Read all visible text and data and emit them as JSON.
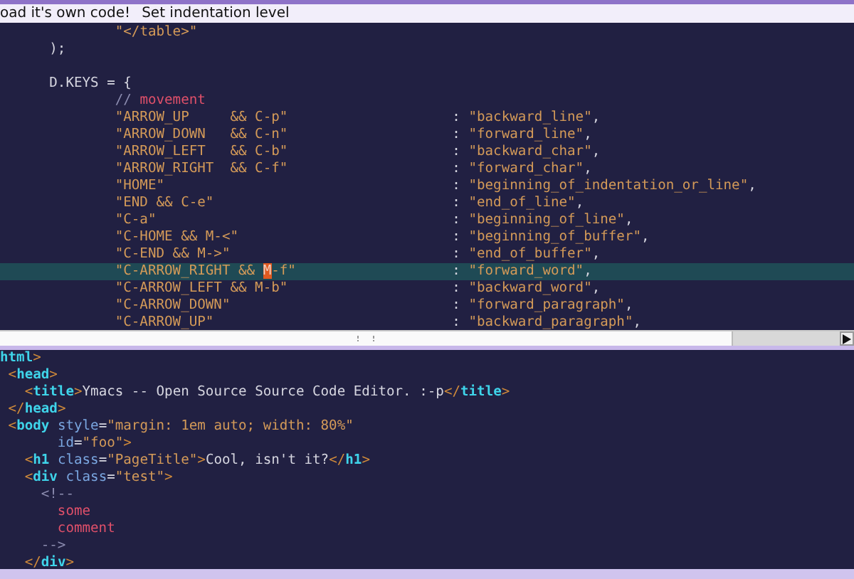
{
  "menu": [
    {
      "label": "oad it's own code!"
    },
    {
      "label": "Set indentation level"
    }
  ],
  "upper": {
    "lines": [
      {
        "kind": "code",
        "current": false,
        "tokens": [
          {
            "kind": "string",
            "text": "              \"</table>\""
          }
        ]
      },
      {
        "kind": "code",
        "current": false,
        "tokens": [
          {
            "kind": "plain",
            "text": "      );"
          }
        ]
      },
      {
        "kind": "blank",
        "current": false
      },
      {
        "kind": "code",
        "current": false,
        "tokens": [
          {
            "kind": "plain",
            "text": "      D.KEYS = {"
          }
        ]
      },
      {
        "kind": "code",
        "current": false,
        "tokens": [
          {
            "kind": "comment",
            "text": "              // "
          },
          {
            "kind": "commenttext",
            "text": "movement"
          }
        ]
      },
      {
        "kind": "pair",
        "current": false,
        "sep": ":",
        "key": [
          {
            "kind": "string",
            "text": "\"ARROW_UP     && C-p\""
          }
        ],
        "value": [
          {
            "kind": "string",
            "text": "\"backward_line\""
          },
          {
            "kind": "plain",
            "text": ","
          }
        ]
      },
      {
        "kind": "pair",
        "current": false,
        "sep": ":",
        "key": [
          {
            "kind": "string",
            "text": "\"ARROW_DOWN   && C-n\""
          }
        ],
        "value": [
          {
            "kind": "string",
            "text": "\"forward_line\""
          },
          {
            "kind": "plain",
            "text": ","
          }
        ]
      },
      {
        "kind": "pair",
        "current": false,
        "sep": ":",
        "key": [
          {
            "kind": "string",
            "text": "\"ARROW_LEFT   && C-b\""
          }
        ],
        "value": [
          {
            "kind": "string",
            "text": "\"backward_char\""
          },
          {
            "kind": "plain",
            "text": ","
          }
        ]
      },
      {
        "kind": "pair",
        "current": false,
        "sep": ":",
        "key": [
          {
            "kind": "string",
            "text": "\"ARROW_RIGHT  && C-f\""
          }
        ],
        "value": [
          {
            "kind": "string",
            "text": "\"forward_char\""
          },
          {
            "kind": "plain",
            "text": ","
          }
        ]
      },
      {
        "kind": "pair",
        "current": false,
        "sep": ":",
        "key": [
          {
            "kind": "string",
            "text": "\"HOME\""
          }
        ],
        "value": [
          {
            "kind": "string",
            "text": "\"beginning_of_indentation_or_line\""
          },
          {
            "kind": "plain",
            "text": ","
          }
        ]
      },
      {
        "kind": "pair",
        "current": false,
        "sep": ":",
        "key": [
          {
            "kind": "string",
            "text": "\"END && C-e\""
          }
        ],
        "value": [
          {
            "kind": "string",
            "text": "\"end_of_line\""
          },
          {
            "kind": "plain",
            "text": ","
          }
        ]
      },
      {
        "kind": "pair",
        "current": false,
        "sep": ":",
        "key": [
          {
            "kind": "string",
            "text": "\"C-a\""
          }
        ],
        "value": [
          {
            "kind": "string",
            "text": "\"beginning_of_line\""
          },
          {
            "kind": "plain",
            "text": ","
          }
        ]
      },
      {
        "kind": "pair",
        "current": false,
        "sep": ":",
        "key": [
          {
            "kind": "string",
            "text": "\"C-HOME && M-<\""
          }
        ],
        "value": [
          {
            "kind": "string",
            "text": "\"beginning_of_buffer\""
          },
          {
            "kind": "plain",
            "text": ","
          }
        ]
      },
      {
        "kind": "pair",
        "current": false,
        "sep": ":",
        "key": [
          {
            "kind": "string",
            "text": "\"C-END && M->\""
          }
        ],
        "value": [
          {
            "kind": "string",
            "text": "\"end_of_buffer\""
          },
          {
            "kind": "plain",
            "text": ","
          }
        ]
      },
      {
        "kind": "pair",
        "current": true,
        "sep": ":",
        "key": [
          {
            "kind": "string",
            "text": "\"C-ARROW_RIGHT && "
          },
          {
            "kind": "cursor",
            "text": "M"
          },
          {
            "kind": "string",
            "text": "-f\""
          }
        ],
        "value": [
          {
            "kind": "string",
            "text": "\"forward_word\""
          },
          {
            "kind": "plain",
            "text": ","
          }
        ]
      },
      {
        "kind": "pair",
        "current": false,
        "sep": ":",
        "key": [
          {
            "kind": "string",
            "text": "\"C-ARROW_LEFT && M-b\""
          }
        ],
        "value": [
          {
            "kind": "string",
            "text": "\"backward_word\""
          },
          {
            "kind": "plain",
            "text": ","
          }
        ]
      },
      {
        "kind": "pair",
        "current": false,
        "sep": ":",
        "key": [
          {
            "kind": "string",
            "text": "\"C-ARROW_DOWN\""
          }
        ],
        "value": [
          {
            "kind": "string",
            "text": "\"forward_paragraph\""
          },
          {
            "kind": "plain",
            "text": ","
          }
        ]
      },
      {
        "kind": "pair",
        "current": false,
        "sep": ":",
        "key": [
          {
            "kind": "string",
            "text": "\"C-ARROW_UP\""
          }
        ],
        "value": [
          {
            "kind": "string",
            "text": "\"backward_paragraph\""
          },
          {
            "kind": "plain",
            "text": ","
          }
        ]
      }
    ]
  },
  "lower": {
    "lines": [
      {
        "kind": "code",
        "current": false,
        "tokens": [
          {
            "kind": "tag",
            "text": "html"
          },
          {
            "kind": "punct",
            "text": ">"
          }
        ]
      },
      {
        "kind": "code",
        "current": false,
        "tokens": [
          {
            "kind": "punct",
            "text": " <"
          },
          {
            "kind": "tag",
            "text": "head"
          },
          {
            "kind": "punct",
            "text": ">"
          }
        ]
      },
      {
        "kind": "code",
        "current": false,
        "tokens": [
          {
            "kind": "punct",
            "text": "   <"
          },
          {
            "kind": "tag",
            "text": "title"
          },
          {
            "kind": "punct",
            "text": ">"
          },
          {
            "kind": "plain",
            "text": "Ymacs -- Open Source Source Code Editor. :-p"
          },
          {
            "kind": "punct",
            "text": "</"
          },
          {
            "kind": "tag",
            "text": "title"
          },
          {
            "kind": "punct",
            "text": ">"
          }
        ]
      },
      {
        "kind": "code",
        "current": false,
        "tokens": [
          {
            "kind": "punct",
            "text": " </"
          },
          {
            "kind": "tag",
            "text": "head"
          },
          {
            "kind": "punct",
            "text": ">"
          }
        ]
      },
      {
        "kind": "code",
        "current": false,
        "tokens": [
          {
            "kind": "punct",
            "text": " <"
          },
          {
            "kind": "tag",
            "text": "body"
          },
          {
            "kind": "attr",
            "text": " style"
          },
          {
            "kind": "plain",
            "text": "="
          },
          {
            "kind": "string",
            "text": "\"margin: 1em auto; width: 80%\""
          }
        ]
      },
      {
        "kind": "code",
        "current": false,
        "tokens": [
          {
            "kind": "attr",
            "text": "       id"
          },
          {
            "kind": "plain",
            "text": "="
          },
          {
            "kind": "string",
            "text": "\"foo\""
          },
          {
            "kind": "punct",
            "text": ">"
          }
        ]
      },
      {
        "kind": "code",
        "current": false,
        "tokens": [
          {
            "kind": "punct",
            "text": "   <"
          },
          {
            "kind": "tag",
            "text": "h1"
          },
          {
            "kind": "attr",
            "text": " class"
          },
          {
            "kind": "plain",
            "text": "="
          },
          {
            "kind": "string",
            "text": "\"PageTitle\""
          },
          {
            "kind": "punct",
            "text": ">"
          },
          {
            "kind": "plain",
            "text": "Cool, isn't it?"
          },
          {
            "kind": "punct",
            "text": "</"
          },
          {
            "kind": "tag",
            "text": "h1"
          },
          {
            "kind": "punct",
            "text": ">"
          }
        ]
      },
      {
        "kind": "code",
        "current": false,
        "tokens": [
          {
            "kind": "punct",
            "text": "   <"
          },
          {
            "kind": "tag",
            "text": "div"
          },
          {
            "kind": "attr",
            "text": " class"
          },
          {
            "kind": "plain",
            "text": "="
          },
          {
            "kind": "string",
            "text": "\"test\""
          },
          {
            "kind": "punct",
            "text": ">"
          }
        ]
      },
      {
        "kind": "code",
        "current": false,
        "tokens": [
          {
            "kind": "comment",
            "text": "     <!--"
          }
        ]
      },
      {
        "kind": "code",
        "current": false,
        "tokens": [
          {
            "kind": "commenttext",
            "text": "       some"
          }
        ]
      },
      {
        "kind": "code",
        "current": false,
        "tokens": [
          {
            "kind": "commenttext",
            "text": "       comment"
          }
        ]
      },
      {
        "kind": "code",
        "current": false,
        "tokens": [
          {
            "kind": "comment",
            "text": "     -->"
          }
        ]
      },
      {
        "kind": "code",
        "current": false,
        "tokens": [
          {
            "kind": "punct",
            "text": "   </"
          },
          {
            "kind": "tag",
            "text": "div"
          },
          {
            "kind": "punct",
            "text": ">"
          }
        ]
      }
    ]
  }
}
